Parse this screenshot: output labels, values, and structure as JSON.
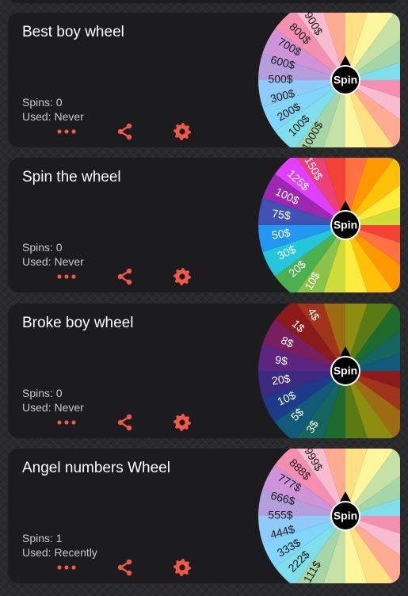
{
  "cards": [
    {
      "title": "Best boy wheel",
      "spins": "Spins: 0",
      "used": "Used: Never",
      "spin_label": "Spin",
      "palette": [
        "#f48fb1",
        "#f8bbd0",
        "#ffab91",
        "#ffe082",
        "#fff59d",
        "#c5e1a5",
        "#a5d6a7",
        "#80deea",
        "#81d4fa",
        "#90caf9",
        "#b39ddb",
        "#ce93d8"
      ],
      "labels": [
        "1000$",
        "100$",
        "200$",
        "300$",
        "500$",
        "600$",
        "700$",
        "800$",
        "900$"
      ],
      "label_color": "#1a1a1a"
    },
    {
      "title": "Spin the wheel",
      "spins": "Spins: 0",
      "used": "Used: Never",
      "spin_label": "Spin",
      "palette": [
        "#f44336",
        "#ff7043",
        "#ff9800",
        "#ffc107",
        "#ffeb3b",
        "#cddc39",
        "#8bc34a",
        "#4caf50",
        "#26c6da",
        "#2196f3",
        "#3f51b5",
        "#9c27b0",
        "#e040fb",
        "#ec407a"
      ],
      "labels": [
        "10$",
        "20$",
        "30$",
        "50$",
        "75$",
        "100$",
        "125$",
        "150$"
      ],
      "label_color": "#ffffff"
    },
    {
      "title": "Broke boy wheel",
      "spins": "Spins: 0",
      "used": "Used: Never",
      "spin_label": "Spin",
      "palette": [
        "#8b1a1a",
        "#a0331a",
        "#9c6b12",
        "#8d8d12",
        "#5a7a14",
        "#1f6b2e",
        "#14665e",
        "#135a7a",
        "#1e3a8a",
        "#3b2a80",
        "#5b2580",
        "#7a1f5e"
      ],
      "labels": [
        "3$",
        "5$",
        "10$",
        "20$",
        "9$",
        "8$",
        "1$",
        "4$"
      ],
      "label_color": "#ffffff"
    },
    {
      "title": "Angel numbers Wheel",
      "spins": "Spins: 1",
      "used": "Used: Recently",
      "spin_label": "Spin",
      "palette": [
        "#f48fb1",
        "#f8bbd0",
        "#ffab91",
        "#ffe082",
        "#fff59d",
        "#c5e1a5",
        "#a5d6a7",
        "#80deea",
        "#81d4fa",
        "#90caf9",
        "#b39ddb",
        "#ce93d8"
      ],
      "labels": [
        "111$",
        "222$",
        "333$",
        "444$",
        "555$",
        "666$",
        "777$",
        "888$",
        "999$"
      ],
      "label_color": "#1a1a1a"
    }
  ],
  "colors": {
    "accent": "#f0584a",
    "card_bg": "#1c1c1e",
    "hub": "#000000"
  },
  "icons": {
    "more": "ellipsis-icon",
    "share": "share-icon",
    "settings": "gear-icon"
  }
}
